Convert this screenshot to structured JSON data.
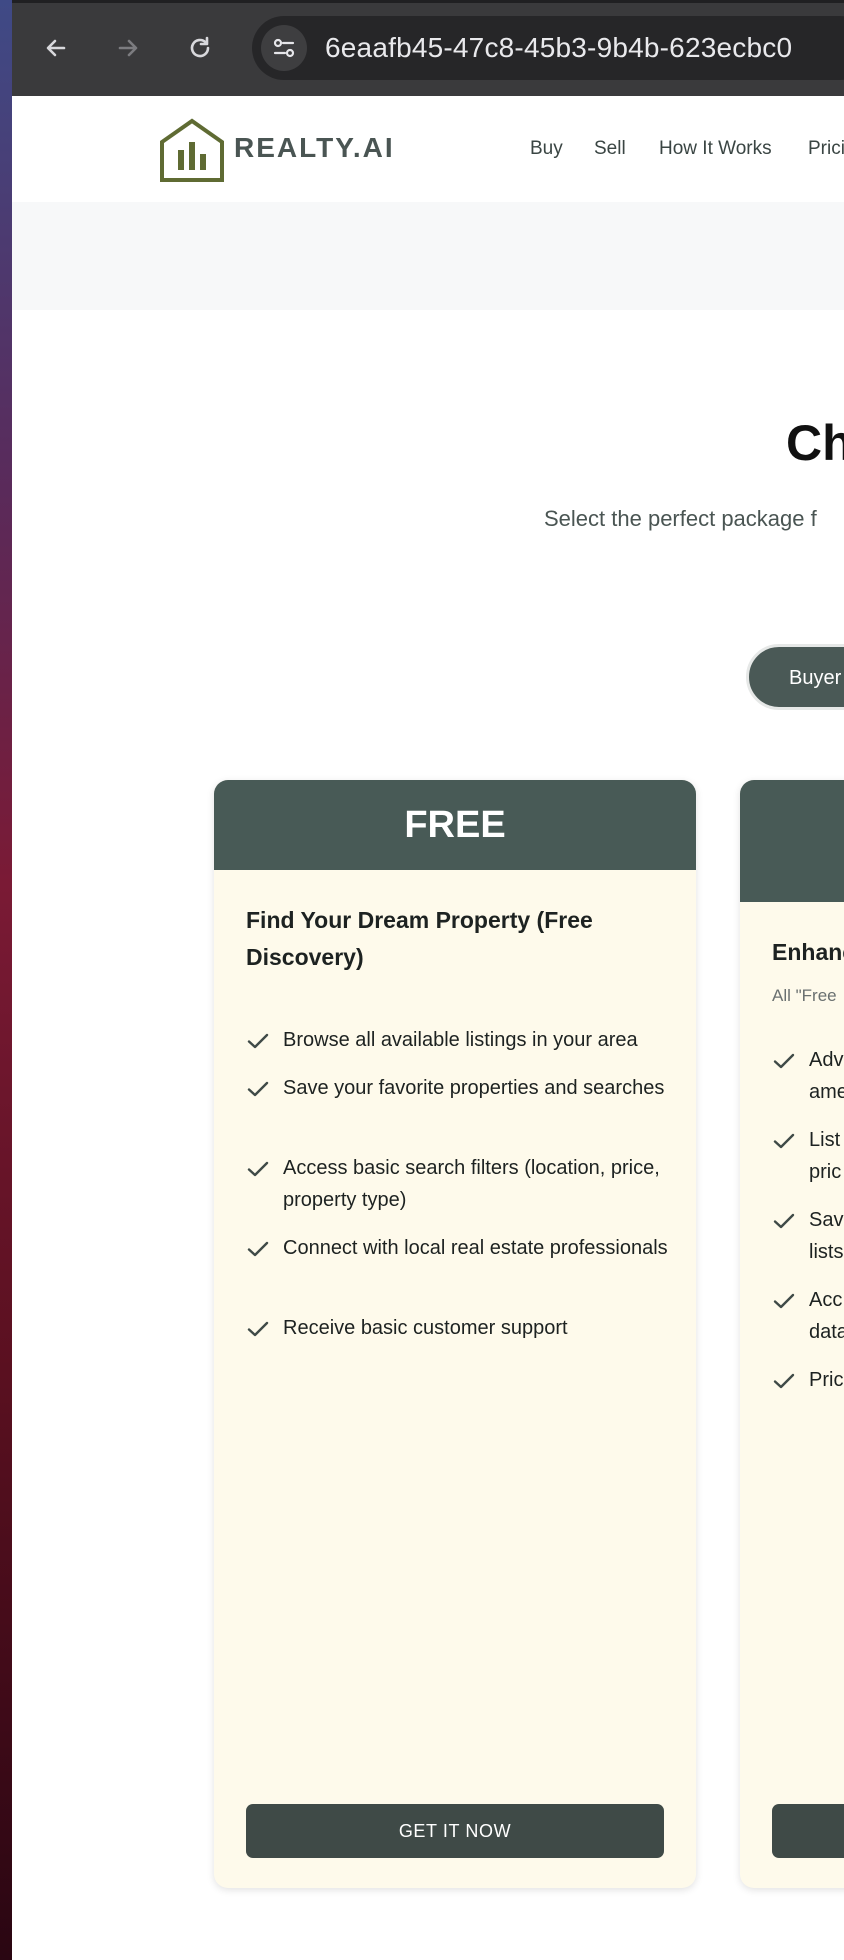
{
  "browser": {
    "url": "6eaafb45-47c8-45b3-9b4b-623ecbc0",
    "back_icon": "back-arrow-icon",
    "forward_icon": "forward-arrow-icon",
    "reload_icon": "reload-icon",
    "site_info_icon": "site-settings-icon"
  },
  "header": {
    "logo_text": "REALTY.AI",
    "logo_icon": "house-chart-icon",
    "nav": [
      "Buy",
      "Sell",
      "How It Works",
      "Prici"
    ]
  },
  "hero": {
    "title": "Ch",
    "subtitle": "Select the perfect package f"
  },
  "toggle": {
    "active_label": "Buyer"
  },
  "cards": [
    {
      "plan": "FREE",
      "headline": "Find Your Dream Property (Free Discovery)",
      "features": [
        "Browse all available listings in your area",
        "Save your favorite properties and searches",
        "Access basic search filters (location, price, property type)",
        "Connect with local real estate professionals",
        "Receive basic customer support"
      ],
      "cta": "GET IT NOW"
    },
    {
      "plan": "",
      "headline": "Enhanc",
      "note": "All \"Free",
      "features": [
        "Adv",
        "List",
        "Sav",
        "Acc",
        "Pric"
      ],
      "feature_second_lines": [
        "ame",
        "pric",
        "lists",
        "data"
      ],
      "cta": ""
    }
  ],
  "colors": {
    "brand_dark": "#485a56",
    "button_dark": "#3f4a47",
    "card_bg": "#fefaeb",
    "logo_olive": "#5f6b33"
  }
}
